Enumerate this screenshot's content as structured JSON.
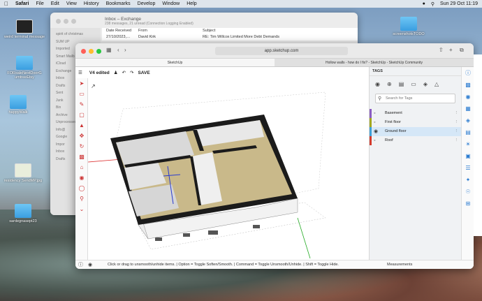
{
  "menubar": {
    "apple": "",
    "app": "Safari",
    "items": [
      "File",
      "Edit",
      "View",
      "History",
      "Bookmarks",
      "Develop",
      "Window",
      "Help"
    ],
    "clock": "Sun 29 Oct  11:19"
  },
  "desktop": {
    "icons": [
      {
        "label": "weird terminal message",
        "kind": "thumb"
      },
      {
        "label": "FORsaleNextDoorG umtreeEtsy",
        "kind": "folder"
      },
      {
        "label": "happyWalk",
        "kind": "folder"
      },
      {
        "label": "residency SendMP.jpg",
        "kind": "thumb"
      },
      {
        "label": "sardegnasept23",
        "kind": "folder"
      },
      {
        "label": "screenshotsTODO",
        "kind": "folder"
      }
    ]
  },
  "mail": {
    "title": "Inbox – Exchange",
    "subtitle": "238 messages, 21 unread (Connection Logging Enabled)",
    "col_date": "Date Received",
    "col_from": "From",
    "col_subject": "Subject",
    "row_date": "27/10/2023,…",
    "row_from": "David Kirk",
    "row_subject": "RE: Tim Willcox Limited More Debt Demands",
    "sidebar": [
      "spirit of christmas",
      "SUM UP",
      "Imported",
      "Smart Mailb",
      "iCloud",
      "Exchange",
      "Inbox",
      "Drafts",
      "Sent",
      "Junk",
      "Bin",
      "Archive",
      "Unprocessed",
      "Info@",
      "Google",
      "Impor",
      "Inbox",
      "Drafts"
    ]
  },
  "safari": {
    "url": "app.sketchup.com",
    "tabs": [
      {
        "label": "SketchUp",
        "active": true
      },
      {
        "label": "Hollow walls - how do I fix? - SketchUp - SketchUp Community",
        "active": false
      }
    ]
  },
  "sketchup": {
    "doc_name": "V4 edited",
    "save": "SAVE",
    "status_msg": "Click or drag to unsmooth/unhide items. | Option = Toggle Soften/Smooth. | Command = Toggle Unsmooth/Unhide. | Shift = Toggle Hide.",
    "measurements": "Measurements"
  },
  "tags": {
    "header": "TAGS",
    "search_placeholder": "Search for Tags",
    "rows": [
      {
        "name": "Basement",
        "color": "#8a5cc2",
        "visible": false,
        "selected": false
      },
      {
        "name": "First floor",
        "color": "#a3a81e",
        "visible": false,
        "selected": false
      },
      {
        "name": "Ground floor",
        "color": "#3fa0d8",
        "visible": true,
        "selected": true
      },
      {
        "name": "Roof",
        "color": "#d33a2c",
        "visible": false,
        "selected": false
      }
    ]
  }
}
